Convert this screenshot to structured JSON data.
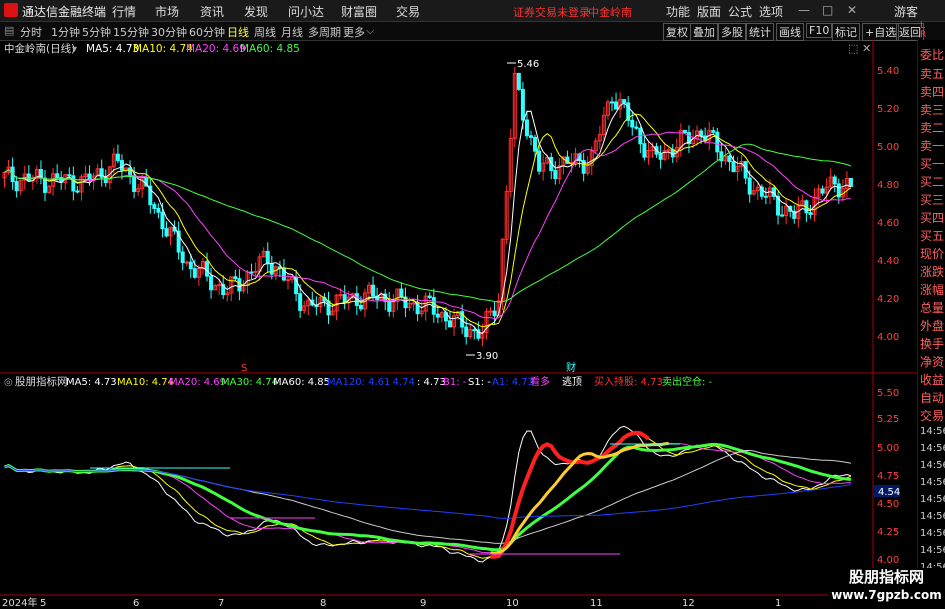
{
  "topbar": {
    "app_title": "通达信金融终端",
    "menus": [
      "行情",
      "市场",
      "资讯",
      "发现",
      "问小达",
      "财富圈",
      "交易"
    ],
    "warning": "证券交易未登录",
    "stock": "中金岭南",
    "right_menus": [
      "功能",
      "版面",
      "公式",
      "选项"
    ],
    "user": "游客"
  },
  "periods": [
    "分时",
    "1分钟",
    "5分钟",
    "15分钟",
    "30分钟",
    "60分钟",
    "日线",
    "周线",
    "月线",
    "多周期",
    "更多"
  ],
  "active_period": "日线",
  "toolbar_right": [
    "复权",
    "叠加",
    "多股",
    "统计",
    "画线",
    "F10",
    "标记",
    "+自选",
    "返回"
  ],
  "main_chart": {
    "title": "中金岭南(日线)",
    "ma": [
      {
        "label": "MA5: 4.73",
        "color": "#ffffff"
      },
      {
        "label": "MA10: 4.74",
        "color": "#ffff00"
      },
      {
        "label": "MA20: 4.69",
        "color": "#ff40ff"
      },
      {
        "label": "MA60: 4.85",
        "color": "#40ff40"
      }
    ],
    "price_labels": [
      "5.40",
      "5.20",
      "5.00",
      "4.80",
      "4.60",
      "4.40",
      "4.20",
      "4.00"
    ],
    "high_label": "5.46",
    "low_label": "3.90",
    "marker_s": "S",
    "marker_cai": "财"
  },
  "sub_chart": {
    "title": "股朋指标网",
    "items": [
      {
        "label": "MA5: 4.73",
        "color": "#ffffff"
      },
      {
        "label": "MA10: 4.74",
        "color": "#ffff00"
      },
      {
        "label": "MA20: 4.69",
        "color": "#ff40ff"
      },
      {
        "label": "MA30: 4.74",
        "color": "#40ff40"
      },
      {
        "label": "MA60: 4.85",
        "color": "#ffffff"
      },
      {
        "label": "MA120: 4.61",
        "color": "#2040ff"
      },
      {
        "label": ": 4.74",
        "color": "#2040ff"
      },
      {
        "label": ": 4.73",
        "color": "#ffffff"
      },
      {
        "label": "B1: -",
        "color": "#ff40ff"
      },
      {
        "label": "S1: -",
        "color": "#ffffff"
      },
      {
        "label": "A1: 4.73",
        "color": "#2040ff"
      },
      {
        "label": "看多",
        "color": "#ff40ff"
      },
      {
        "label": "逃顶",
        "color": "#ffffff"
      },
      {
        "label": "买入持股: 4.73",
        "color": "#ff3030"
      },
      {
        "label": "卖出空仓: -",
        "color": "#40ff40"
      }
    ],
    "price_labels": [
      "5.50",
      "5.25",
      "5.00",
      "4.75",
      "4.50",
      "4.25",
      "4.00"
    ],
    "current_price": "4.54",
    "sidebar_prices": [
      "14:56",
      "14:56",
      "14:56",
      "14:56",
      "14:56",
      "14:56",
      "14:56",
      "14:56",
      "14:56",
      "14:56"
    ]
  },
  "sidebar": [
    "委比",
    "卖五",
    "卖四",
    "卖三",
    "卖二",
    "卖一",
    "买一",
    "买二",
    "买三",
    "买四",
    "买五",
    "现价",
    "涨跌",
    "涨幅",
    "总量",
    "外盘",
    "换手",
    "净资",
    "收益",
    "自动",
    "交易"
  ],
  "x_axis": [
    "2024年",
    "5",
    "6",
    "7",
    "8",
    "9",
    "10",
    "11",
    "12",
    "1"
  ],
  "watermark": "股朋指标网",
  "watermark_url": "www.7gpzb.com",
  "colors": {
    "up": "#ff3030",
    "down": "#30ffff",
    "axis": "#aa0000"
  }
}
